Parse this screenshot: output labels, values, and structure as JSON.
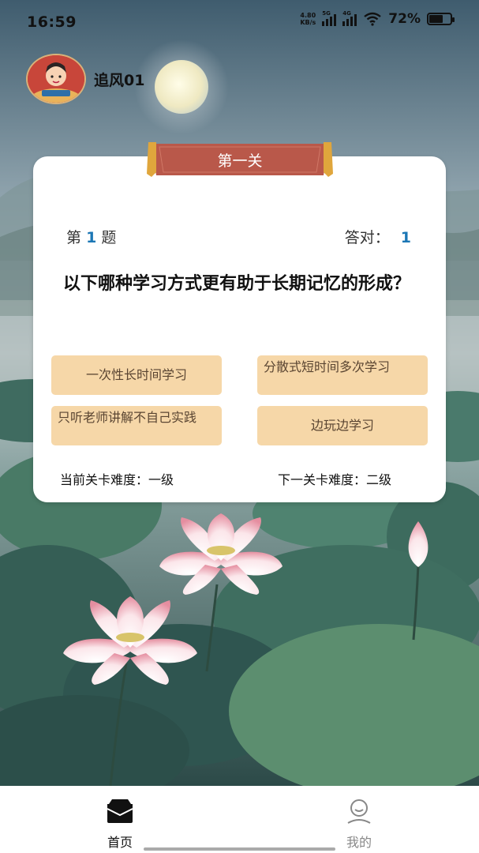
{
  "status_bar": {
    "time": "16:59",
    "net_speed_value": "4.80",
    "net_speed_unit": "KB/s",
    "signal_1": "5G",
    "signal_2": "4G",
    "battery": "72%",
    "battery_level": 0.72
  },
  "user": {
    "name": "追风01",
    "avatar_icon": "avatar-character-icon"
  },
  "level": {
    "title": "第一关"
  },
  "question": {
    "index_prefix": "第",
    "index_number": "1",
    "index_suffix": "题",
    "correct_label": "答对：",
    "correct_count": "1",
    "text": "以下哪种学习方式更有助于长期记忆的形成？",
    "options": [
      "一次性长时间学习",
      "分散式短时间多次学习",
      "只听老师讲解不自己实践",
      "边玩边学习"
    ]
  },
  "difficulty": {
    "current": "当前关卡难度：一级",
    "next": "下一关卡难度：二级"
  },
  "nav": {
    "home_label": "首页",
    "mine_label": "我的",
    "home_icon": "home-icon",
    "mine_icon": "user-icon",
    "active_color": "#111111",
    "inactive_color": "#888888"
  },
  "colors": {
    "option_bg": "#f6d7a8",
    "ribbon": "#b9584a",
    "accent_number": "#1c77b5"
  }
}
